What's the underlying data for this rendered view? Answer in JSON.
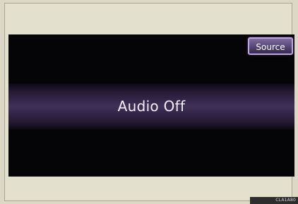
{
  "screen": {
    "source_button_label": "Source",
    "status_text": "Audio Off"
  },
  "footer": {
    "code": "CLA1A80"
  },
  "colors": {
    "page_background": "#ddd8c6",
    "screen_background": "#050507",
    "source_button_border": "#bfa6e3",
    "status_band_center": "#3f3059"
  }
}
